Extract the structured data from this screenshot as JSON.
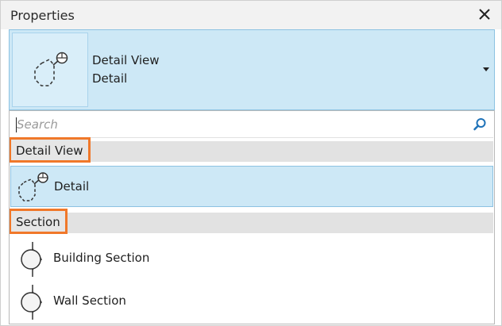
{
  "panel": {
    "title": "Properties",
    "close_icon": "close-icon"
  },
  "type_selector": {
    "family": "Detail View",
    "type": "Detail",
    "icon": "detail-view-icon",
    "arrow_icon": "chevron-down-icon"
  },
  "search": {
    "placeholder": "Search",
    "value": "",
    "icon": "search-icon"
  },
  "groups": [
    {
      "label": "Detail View",
      "items": [
        {
          "label": "Detail",
          "icon": "detail-view-icon",
          "selected": true
        }
      ]
    },
    {
      "label": "Section",
      "items": [
        {
          "label": "Building Section",
          "icon": "section-icon",
          "selected": false
        },
        {
          "label": "Wall Section",
          "icon": "section-icon",
          "selected": false
        }
      ]
    }
  ],
  "colors": {
    "selection": "#cde8f6",
    "selection_border": "#8cc2e2",
    "highlight_outline": "#f0782a",
    "group_header": "#e2e2e2"
  }
}
